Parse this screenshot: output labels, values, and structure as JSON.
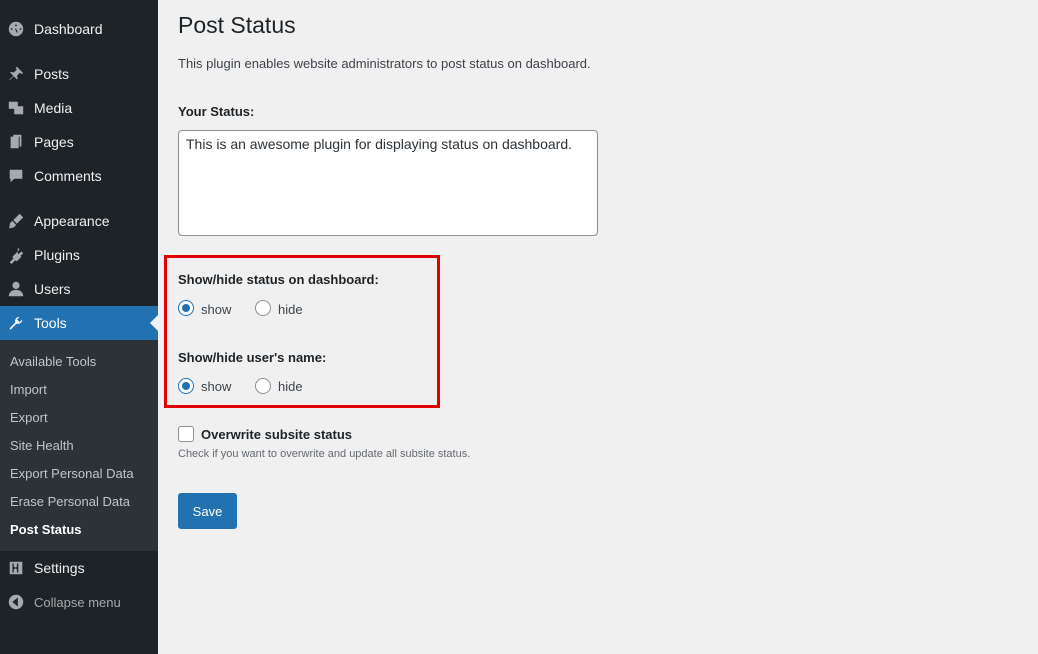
{
  "sidebar": {
    "items": [
      {
        "label": "Dashboard",
        "icon": "dashboard-icon"
      },
      {
        "label": "Posts",
        "icon": "pin-icon"
      },
      {
        "label": "Media",
        "icon": "media-icon"
      },
      {
        "label": "Pages",
        "icon": "pages-icon"
      },
      {
        "label": "Comments",
        "icon": "comment-icon"
      },
      {
        "label": "Appearance",
        "icon": "brush-icon"
      },
      {
        "label": "Plugins",
        "icon": "plugin-icon"
      },
      {
        "label": "Users",
        "icon": "user-icon"
      },
      {
        "label": "Tools",
        "icon": "wrench-icon",
        "active": true
      },
      {
        "label": "Settings",
        "icon": "settings-sliders-icon"
      }
    ],
    "submenu": [
      "Available Tools",
      "Import",
      "Export",
      "Site Health",
      "Export Personal Data",
      "Erase Personal Data",
      "Post Status"
    ],
    "current_submenu": "Post Status",
    "collapse_label": "Collapse menu"
  },
  "main": {
    "title": "Post Status",
    "description": "This plugin enables website administrators to post status on dashboard.",
    "status_label": "Your Status:",
    "status_value": "This is an awesome plugin for displaying status on dashboard.",
    "dashboard_toggle": {
      "label": "Show/hide status on dashboard:",
      "options": [
        "show",
        "hide"
      ],
      "selected": "show"
    },
    "username_toggle": {
      "label": "Show/hide user's name:",
      "options": [
        "show",
        "hide"
      ],
      "selected": "show"
    },
    "overwrite": {
      "label": "Overwrite subsite status",
      "hint": "Check if you want to overwrite and update all subsite status.",
      "checked": false
    },
    "save_label": "Save"
  },
  "colors": {
    "sidebar_bg": "#1d2327",
    "submenu_bg": "#2c3338",
    "accent": "#2271b1",
    "highlight": "#e00000",
    "page_bg": "#f0f0f1"
  }
}
